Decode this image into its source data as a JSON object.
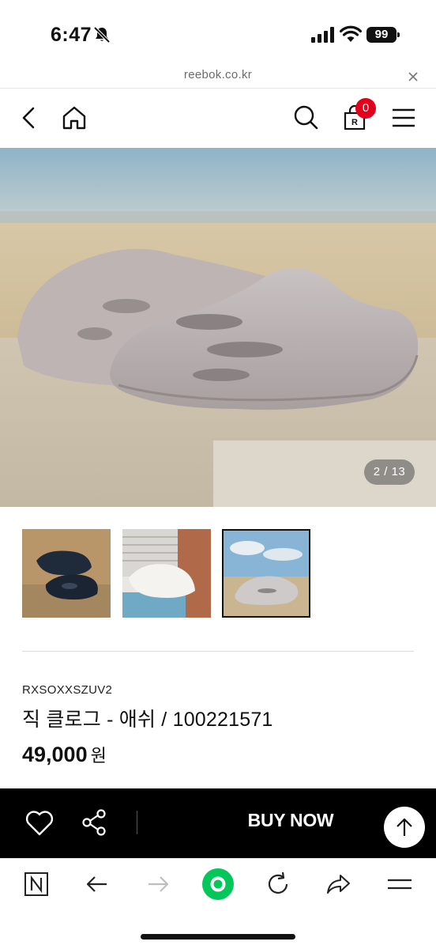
{
  "status_bar": {
    "time": "6:47",
    "battery": "99",
    "icons": [
      "bell-slash-icon",
      "cellular-signal-icon",
      "wifi-icon",
      "battery-icon"
    ]
  },
  "url_bar": {
    "url": "reebok.co.kr",
    "close_icon": "close-icon"
  },
  "header": {
    "icons": [
      "back-chevron-icon",
      "home-icon",
      "search-icon",
      "cart-bag-icon",
      "hamburger-menu-icon"
    ],
    "cart_count": "0",
    "cart_badge_color": "#e2001a"
  },
  "hero": {
    "image": "grey-clog-on-beach-photo",
    "counter": "2 / 13"
  },
  "thumbnails": [
    {
      "image": "navy-clogs-on-sand-thumb",
      "selected": false
    },
    {
      "image": "white-clog-by-window-thumb",
      "selected": false
    },
    {
      "image": "grey-clog-beach-sky-thumb",
      "selected": true
    }
  ],
  "product": {
    "sku": "RXSOXXSZUV2",
    "name": "직 클로그 - 애쉬 / 100221571",
    "price": "49,000",
    "price_unit": "원"
  },
  "buy_bar": {
    "buy_now_label": "BUY NOW",
    "icons": [
      "heart-icon",
      "share-icon",
      "arrow-up-icon"
    ],
    "background": "#000000"
  },
  "browser_toolbar": {
    "icons": [
      "naver-n-icon",
      "back-arrow-icon",
      "forward-arrow-icon",
      "green-home-circle-icon",
      "reload-icon",
      "share-arrow-icon",
      "menu-lines-icon"
    ],
    "accent_color": "#03c75a"
  }
}
